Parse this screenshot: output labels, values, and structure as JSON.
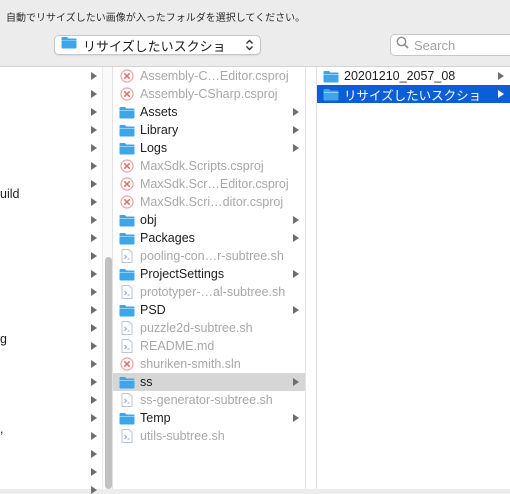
{
  "prompt": "自動でリサイズしたい画像が入ったフォルダを選択してください。",
  "location": {
    "label": "リサイズしたいスクショ"
  },
  "search": {
    "placeholder": "Search"
  },
  "column0": {
    "fragments": [
      "uild",
      "g",
      ","
    ]
  },
  "column1": {
    "items": [
      {
        "name": "Assembly-C…Editor.csproj",
        "type": "csproj",
        "dim": true,
        "folder": false
      },
      {
        "name": "Assembly-CSharp.csproj",
        "type": "csproj",
        "dim": true,
        "folder": false
      },
      {
        "name": "Assets",
        "type": "folder",
        "dim": false,
        "folder": true
      },
      {
        "name": "Library",
        "type": "folder",
        "dim": false,
        "folder": true
      },
      {
        "name": "Logs",
        "type": "folder",
        "dim": false,
        "folder": true
      },
      {
        "name": "MaxSdk.Scripts.csproj",
        "type": "csproj",
        "dim": true,
        "folder": false
      },
      {
        "name": "MaxSdk.Scr…Editor.csproj",
        "type": "csproj",
        "dim": true,
        "folder": false
      },
      {
        "name": "MaxSdk.Scri…ditor.csproj",
        "type": "csproj",
        "dim": true,
        "folder": false
      },
      {
        "name": "obj",
        "type": "folder",
        "dim": false,
        "folder": true
      },
      {
        "name": "Packages",
        "type": "folder",
        "dim": false,
        "folder": true
      },
      {
        "name": "pooling-con…r-subtree.sh",
        "type": "script",
        "dim": true,
        "folder": false
      },
      {
        "name": "ProjectSettings",
        "type": "folder",
        "dim": false,
        "folder": true
      },
      {
        "name": "prototyper-…al-subtree.sh",
        "type": "script",
        "dim": true,
        "folder": false
      },
      {
        "name": "PSD",
        "type": "folder",
        "dim": false,
        "folder": true
      },
      {
        "name": "puzzle2d-subtree.sh",
        "type": "script",
        "dim": true,
        "folder": false
      },
      {
        "name": "README.md",
        "type": "script",
        "dim": true,
        "folder": false
      },
      {
        "name": "shuriken-smith.sln",
        "type": "csproj",
        "dim": true,
        "folder": false
      },
      {
        "name": "ss",
        "type": "folder",
        "dim": false,
        "folder": true,
        "selected": true
      },
      {
        "name": "ss-generator-subtree.sh",
        "type": "script",
        "dim": true,
        "folder": false
      },
      {
        "name": "Temp",
        "type": "folder",
        "dim": false,
        "folder": true
      },
      {
        "name": "utils-subtree.sh",
        "type": "script",
        "dim": true,
        "folder": false
      }
    ]
  },
  "column2": {
    "items": [
      {
        "name": "20201210_2057_08",
        "type": "folder",
        "folder": true
      },
      {
        "name": "リサイズしたいスクショ",
        "type": "folder",
        "folder": true,
        "selected": true
      }
    ]
  },
  "colors": {
    "folder": "#3ea6e8",
    "selection": "#0a5fd6",
    "grey_selection": "#d6d6d6"
  }
}
